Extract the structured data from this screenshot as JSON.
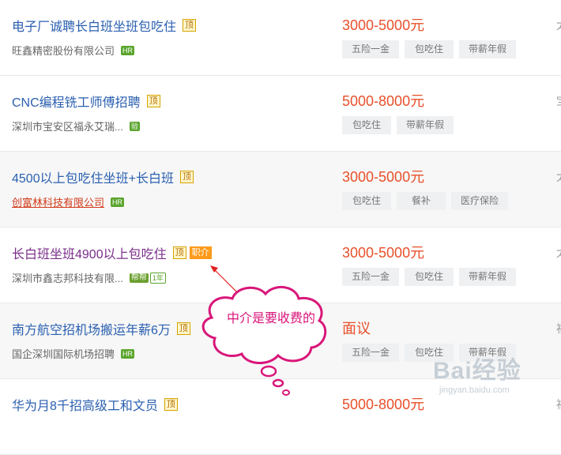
{
  "jobs": [
    {
      "title": "电子厂诚聘长白班坐班包吃住",
      "top_badge": "顶",
      "company": "旺鑫精密股份有限公司",
      "company_tags": [
        "HR"
      ],
      "salary": "3000-5000元",
      "benefits": [
        "五险一金",
        "包吃住",
        "带薪年假"
      ],
      "edge": "太"
    },
    {
      "title": "CNC编程铣工师傅招聘",
      "top_badge": "顶",
      "company": "深圳市宝安区福永艾瑞...",
      "company_tags": [
        "验"
      ],
      "salary": "5000-8000元",
      "benefits": [
        "包吃住",
        "带薪年假"
      ],
      "edge": "宝"
    },
    {
      "title": "4500以上包吃住坐班+长白班",
      "top_badge": "顶",
      "company": "创富林科技有限公司",
      "company_tags": [
        "HR"
      ],
      "salary": "3000-5000元",
      "benefits": [
        "包吃住",
        "餐补",
        "医疗保险"
      ],
      "edge": "太"
    },
    {
      "title": "长白班坐班4900以上包吃住",
      "top_badge": "顶",
      "agent_badge": "职介",
      "company": "深圳市鑫志邦科技有限...",
      "company_tags": [
        "帮帮",
        "1年"
      ],
      "salary": "3000-5000元",
      "benefits": [
        "五险一金",
        "包吃住",
        "带薪年假"
      ],
      "edge": "太"
    },
    {
      "title": "南方航空招机场搬运年薪6万",
      "top_badge": "顶",
      "company": "国企深圳国际机场招聘",
      "company_tags": [
        "HR"
      ],
      "salary": "面议",
      "benefits": [
        "五险一金",
        "包吃住",
        "带薪年假"
      ],
      "edge": "福"
    },
    {
      "title": "华为月8千招高级工和文员",
      "top_badge": "顶",
      "salary": "5000-8000元",
      "edge": "福"
    }
  ],
  "annotation": {
    "text": "中介是要收费的",
    "color": "#d9167a",
    "arrow_color": "#e0201f"
  },
  "watermark": {
    "main": "Bai经验",
    "sub": "jingyan.baidu.com"
  },
  "colors": {
    "title": "#2a5fb0",
    "visited_title": "#7a2d8a",
    "salary": "#e8502a",
    "tag_bg": "#eef0f2"
  }
}
